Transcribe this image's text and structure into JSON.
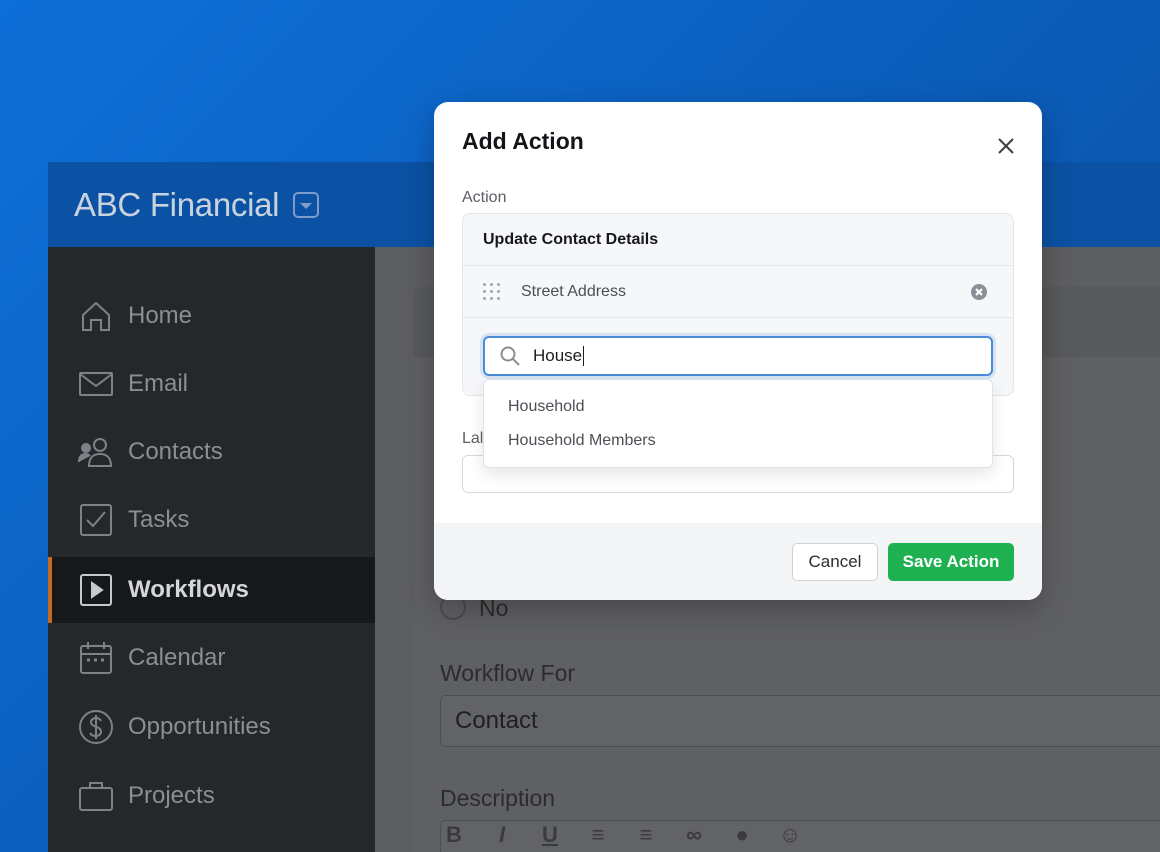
{
  "app": {
    "title": "ABC Financial"
  },
  "sidebar": {
    "items": [
      {
        "label": "Home",
        "icon": "home-icon"
      },
      {
        "label": "Email",
        "icon": "mail-icon"
      },
      {
        "label": "Contacts",
        "icon": "contacts-icon"
      },
      {
        "label": "Tasks",
        "icon": "checkbox-icon"
      },
      {
        "label": "Workflows",
        "icon": "play-icon",
        "active": true
      },
      {
        "label": "Calendar",
        "icon": "calendar-icon"
      },
      {
        "label": "Opportunities",
        "icon": "dollar-icon"
      },
      {
        "label": "Projects",
        "icon": "briefcase-icon"
      }
    ]
  },
  "background_form": {
    "radio_no_label": "No",
    "workflow_for_label": "Workflow For",
    "workflow_for_value": "Contact",
    "description_label": "Description",
    "toolbar": [
      "B",
      "I",
      "U",
      "ordered-list",
      "bullet-list",
      "link",
      "mic",
      "emoji"
    ]
  },
  "modal": {
    "title": "Add Action",
    "action_label": "Action",
    "action_name": "Update Contact Details",
    "fields": [
      {
        "label": "Street Address"
      }
    ],
    "search": {
      "value": "House",
      "placeholder": ""
    },
    "dropdown_options": [
      "Household",
      "Household Members"
    ],
    "label_field_label": "Lal",
    "cancel_label": "Cancel",
    "save_label": "Save Action"
  },
  "colors": {
    "primary_blue": "#0b52a4",
    "save_green": "#1fb052",
    "active_accent": "#c56a1e",
    "focus_blue": "#4a8cd8"
  }
}
